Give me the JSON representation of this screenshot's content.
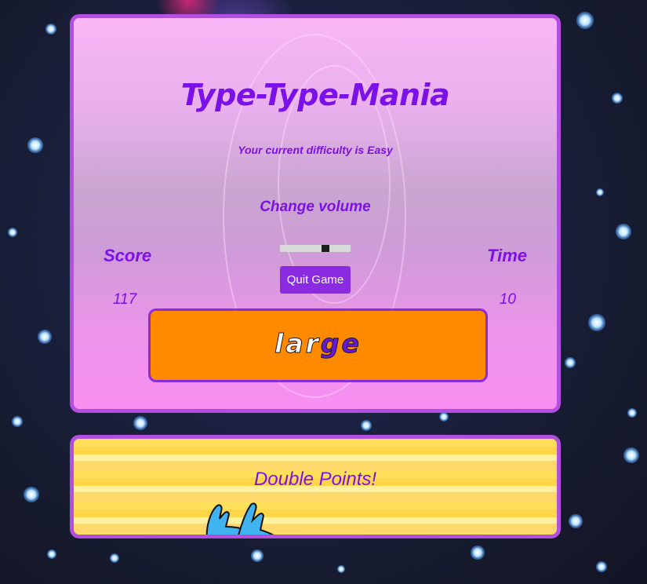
{
  "game": {
    "title": "Type-Type-Mania",
    "difficulty_text": "Your current difficulty is Easy",
    "volume_label": "Change volume",
    "volume_level": 0.66,
    "score_label": "Score",
    "score_value": "117",
    "time_label": "Time",
    "time_value": "10",
    "quit_label": "Quit Game",
    "word_typed": "lar",
    "word_remaining": "ge"
  },
  "bonus": {
    "text": "Double Points!"
  },
  "colors": {
    "accent_purple": "#7b10e8",
    "panel_border": "#b24fe0",
    "word_box": "#ff8a00",
    "quit_button": "#8a2be2"
  },
  "icons": {
    "creature": "blue-bird-creature-icon"
  }
}
